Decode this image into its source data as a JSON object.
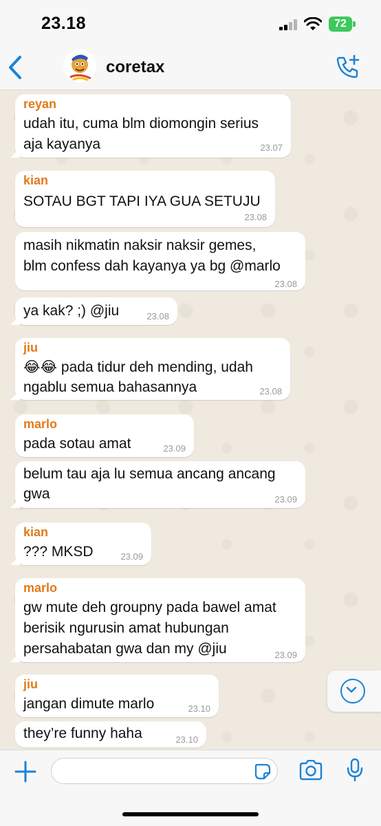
{
  "status": {
    "time": "23.18",
    "battery": "72"
  },
  "header": {
    "title": "coretax"
  },
  "messages": [
    {
      "sender": "reyan",
      "lines": [
        "udah itu, cuma blm diomongin serius",
        "aja kayanya"
      ],
      "time": "23.07"
    },
    {
      "sender": "kian",
      "lines": [
        "SOTAU BGT TAPI IYA GUA SETUJU"
      ],
      "time": "23.08"
    },
    {
      "sender": "",
      "lines": [
        "masih nikmatin naksir naksir gemes,",
        "blm confess dah kayanya ya bg @marlo"
      ],
      "time": "23.08"
    },
    {
      "sender": "",
      "lines": [
        "ya kak? ;) @jiu"
      ],
      "time": "23.08"
    },
    {
      "sender": "jiu",
      "lines": [
        "😂😂 pada tidur deh mending, udah",
        "ngablu semua bahasannya"
      ],
      "time": "23.08"
    },
    {
      "sender": "marlo",
      "lines": [
        "pada sotau amat"
      ],
      "time": "23.09"
    },
    {
      "sender": "",
      "lines": [
        "belum tau aja lu semua ancang ancang",
        "gwa"
      ],
      "time": "23.09"
    },
    {
      "sender": "kian",
      "lines": [
        "??? MKSD"
      ],
      "time": "23.09"
    },
    {
      "sender": "marlo",
      "lines": [
        "gw mute deh groupny pada bawel amat",
        "berisik ngurusin amat hubungan",
        "persahabatan gwa dan my @jiu"
      ],
      "time": "23.09"
    },
    {
      "sender": "jiu",
      "lines": [
        "jangan dimute marlo"
      ],
      "time": "23.10"
    },
    {
      "sender": "",
      "lines": [
        "they’re funny haha"
      ],
      "time": "23.10"
    }
  ],
  "input": {
    "value": "",
    "placeholder": ""
  },
  "colors": {
    "accent": "#1a82d6",
    "sender_name": "#e17a1a",
    "battery": "#3ec95c"
  },
  "icons": [
    "back-chevron-icon",
    "add-call-icon",
    "scroll-down-icon",
    "plus-icon",
    "sticker-icon",
    "camera-icon",
    "microphone-icon"
  ]
}
